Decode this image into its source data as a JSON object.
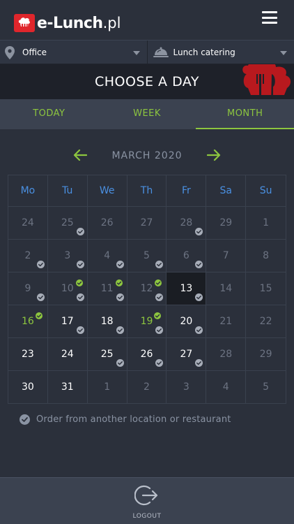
{
  "app": {
    "logo_text": "e-Lunch",
    "logo_suffix": ".pl"
  },
  "selectors": {
    "location": "Office",
    "restaurant": "Lunch catering"
  },
  "header": {
    "title": "CHOOSE A DAY"
  },
  "tabs": [
    {
      "label": "TODAY",
      "active": false
    },
    {
      "label": "WEEK",
      "active": false
    },
    {
      "label": "MONTH",
      "active": true
    }
  ],
  "month": {
    "label": "MARCH 2020"
  },
  "weekdays": [
    "Mo",
    "Tu",
    "We",
    "Th",
    "Fr",
    "Sa",
    "Su"
  ],
  "weeks": [
    [
      {
        "day": "24",
        "style": "muted",
        "badge": "none"
      },
      {
        "day": "25",
        "style": "muted",
        "badge": "grey"
      },
      {
        "day": "26",
        "style": "muted",
        "badge": "none"
      },
      {
        "day": "27",
        "style": "muted",
        "badge": "none"
      },
      {
        "day": "28",
        "style": "muted",
        "badge": "grey"
      },
      {
        "day": "29",
        "style": "muted",
        "badge": "none"
      },
      {
        "day": "1",
        "style": "muted",
        "badge": "none"
      }
    ],
    [
      {
        "day": "2",
        "style": "muted",
        "badge": "grey"
      },
      {
        "day": "3",
        "style": "muted",
        "badge": "grey"
      },
      {
        "day": "4",
        "style": "muted",
        "badge": "grey"
      },
      {
        "day": "5",
        "style": "muted",
        "badge": "grey"
      },
      {
        "day": "6",
        "style": "muted",
        "badge": "grey"
      },
      {
        "day": "7",
        "style": "muted",
        "badge": "none"
      },
      {
        "day": "8",
        "style": "muted",
        "badge": "none"
      }
    ],
    [
      {
        "day": "9",
        "style": "muted",
        "badge": "grey"
      },
      {
        "day": "10",
        "style": "muted",
        "badge": "grey",
        "ordered": true
      },
      {
        "day": "11",
        "style": "muted",
        "badge": "grey",
        "ordered": true
      },
      {
        "day": "12",
        "style": "muted",
        "badge": "grey",
        "ordered": true
      },
      {
        "day": "13",
        "style": "selected",
        "badge": "grey"
      },
      {
        "day": "14",
        "style": "muted",
        "badge": "none"
      },
      {
        "day": "15",
        "style": "muted",
        "badge": "none"
      }
    ],
    [
      {
        "day": "16",
        "style": "green",
        "badge": "none",
        "ordered": true
      },
      {
        "day": "17",
        "style": "white",
        "badge": "grey"
      },
      {
        "day": "18",
        "style": "white",
        "badge": "grey"
      },
      {
        "day": "19",
        "style": "green",
        "badge": "grey",
        "ordered": true
      },
      {
        "day": "20",
        "style": "white",
        "badge": "grey"
      },
      {
        "day": "21",
        "style": "muted",
        "badge": "none"
      },
      {
        "day": "22",
        "style": "muted",
        "badge": "none"
      }
    ],
    [
      {
        "day": "23",
        "style": "white",
        "badge": "none"
      },
      {
        "day": "24",
        "style": "white",
        "badge": "none"
      },
      {
        "day": "25",
        "style": "white",
        "badge": "grey"
      },
      {
        "day": "26",
        "style": "white",
        "badge": "grey"
      },
      {
        "day": "27",
        "style": "white",
        "badge": "grey"
      },
      {
        "day": "28",
        "style": "muted",
        "badge": "none"
      },
      {
        "day": "29",
        "style": "muted",
        "badge": "none"
      }
    ],
    [
      {
        "day": "30",
        "style": "white",
        "badge": "none"
      },
      {
        "day": "31",
        "style": "white",
        "badge": "none"
      },
      {
        "day": "1",
        "style": "muted",
        "badge": "none"
      },
      {
        "day": "2",
        "style": "muted",
        "badge": "none"
      },
      {
        "day": "3",
        "style": "muted",
        "badge": "none"
      },
      {
        "day": "4",
        "style": "muted",
        "badge": "none"
      },
      {
        "day": "5",
        "style": "muted",
        "badge": "none"
      }
    ]
  ],
  "order_option": {
    "label": "Order from another location or restaurant",
    "checked": true
  },
  "footer": {
    "logout_label": "LOGOUT"
  },
  "colors": {
    "accent_green": "#8dc63f",
    "weekday_blue": "#4a90e2",
    "brand_red": "#e0262c",
    "background": "#2b303b"
  },
  "icons": {
    "location": "map-pin-icon",
    "restaurant": "cloche-icon",
    "menu": "hamburger-icon",
    "prev": "arrow-left-icon",
    "next": "arrow-right-icon",
    "logout": "logout-icon",
    "checkbox": "check-circle-icon"
  }
}
